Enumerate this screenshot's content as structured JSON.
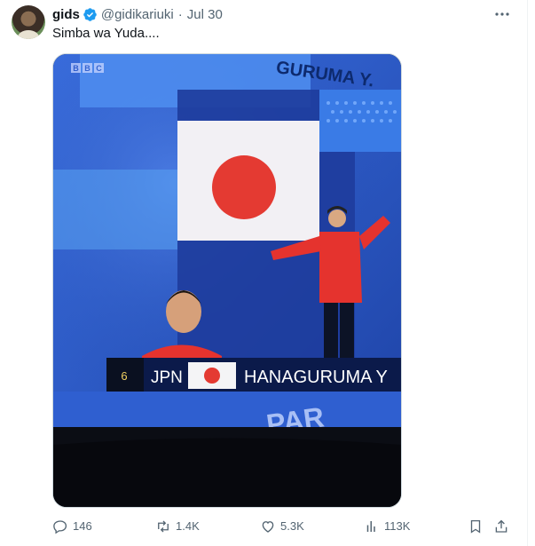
{
  "tweet": {
    "author_name": "gids",
    "handle": "@gidikariuki",
    "separator": "·",
    "time": "Jul 30",
    "text": "Simba wa Yuda....",
    "media": {
      "broadcaster": "BBC",
      "banner_top": "GURUMA Y.",
      "rank": "6",
      "country": "JPN",
      "athlete": "HANAGURUMA Y",
      "bottom_text": "PAR"
    },
    "stats": {
      "replies": "146",
      "reposts": "1.4K",
      "likes": "5.3K",
      "views": "113K"
    }
  },
  "colors": {
    "verified": "#1d9bf0",
    "text_muted": "#536471",
    "flag_red": "#e43a32",
    "screen_blue": "#2d58c8"
  },
  "icons": [
    "verified-badge-icon",
    "more-icon",
    "reply-icon",
    "repost-icon",
    "like-icon",
    "views-icon",
    "bookmark-icon",
    "share-icon"
  ]
}
